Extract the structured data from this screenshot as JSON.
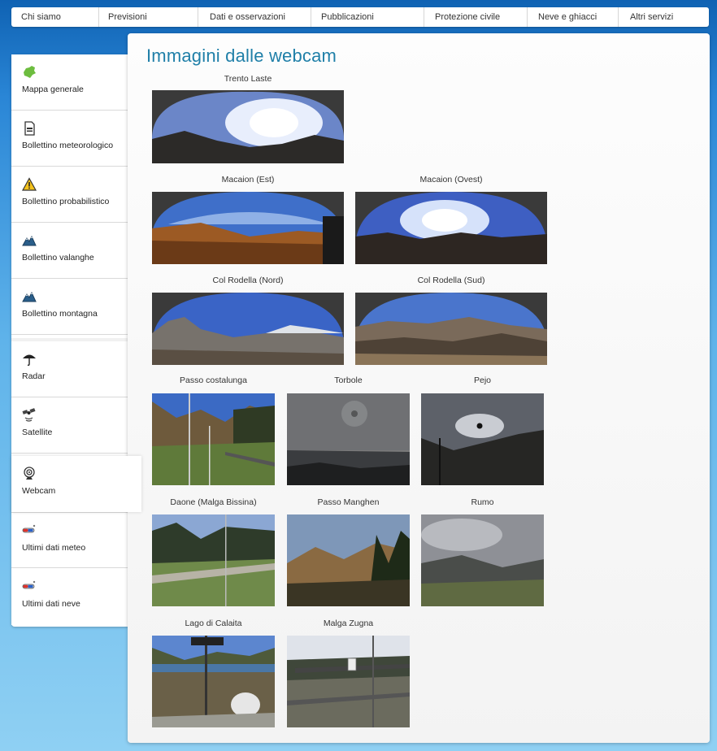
{
  "nav": {
    "items": [
      "Chi siamo",
      "Previsioni",
      "Dati e osservazioni",
      "Pubblicazioni",
      "Protezione civile",
      "Neve e ghiacci",
      "Altri servizi"
    ]
  },
  "sidebar": {
    "items": [
      {
        "label": "Mappa generale",
        "icon": "trentino-map-icon"
      },
      {
        "label": "Bollettino meteorologico",
        "icon": "document-icon"
      },
      {
        "label": "Bollettino probabilistico",
        "icon": "warning-triangle-icon"
      },
      {
        "label": "Bollettino valanghe",
        "icon": "mountain-icon"
      },
      {
        "label": "Bollettino montagna",
        "icon": "mountain-icon"
      },
      {
        "label": "Radar",
        "icon": "umbrella-icon"
      },
      {
        "label": "Satellite",
        "icon": "satellite-icon"
      },
      {
        "label": "Webcam",
        "icon": "webcam-icon"
      },
      {
        "label": "Ultimi dati meteo",
        "icon": "thermometer-icon"
      },
      {
        "label": "Ultimi dati neve",
        "icon": "thermometer-icon"
      }
    ],
    "active": "Webcam"
  },
  "main": {
    "title": "Immagini dalle webcam",
    "webcams": [
      "Trento Laste",
      "Macaion (Est)",
      "Macaion (Ovest)",
      "Col Rodella (Nord)",
      "Col Rodella (Sud)",
      "Passo costalunga",
      "Torbole",
      "Pejo",
      "Daone (Malga Bissina)",
      "Passo Manghen",
      "Rumo",
      "Lago di Calaita",
      "Malga Zugna"
    ]
  },
  "colors": {
    "title": "#1f7fa8",
    "background_top": "#0f62b3",
    "background_bottom": "#8fd0f3"
  }
}
